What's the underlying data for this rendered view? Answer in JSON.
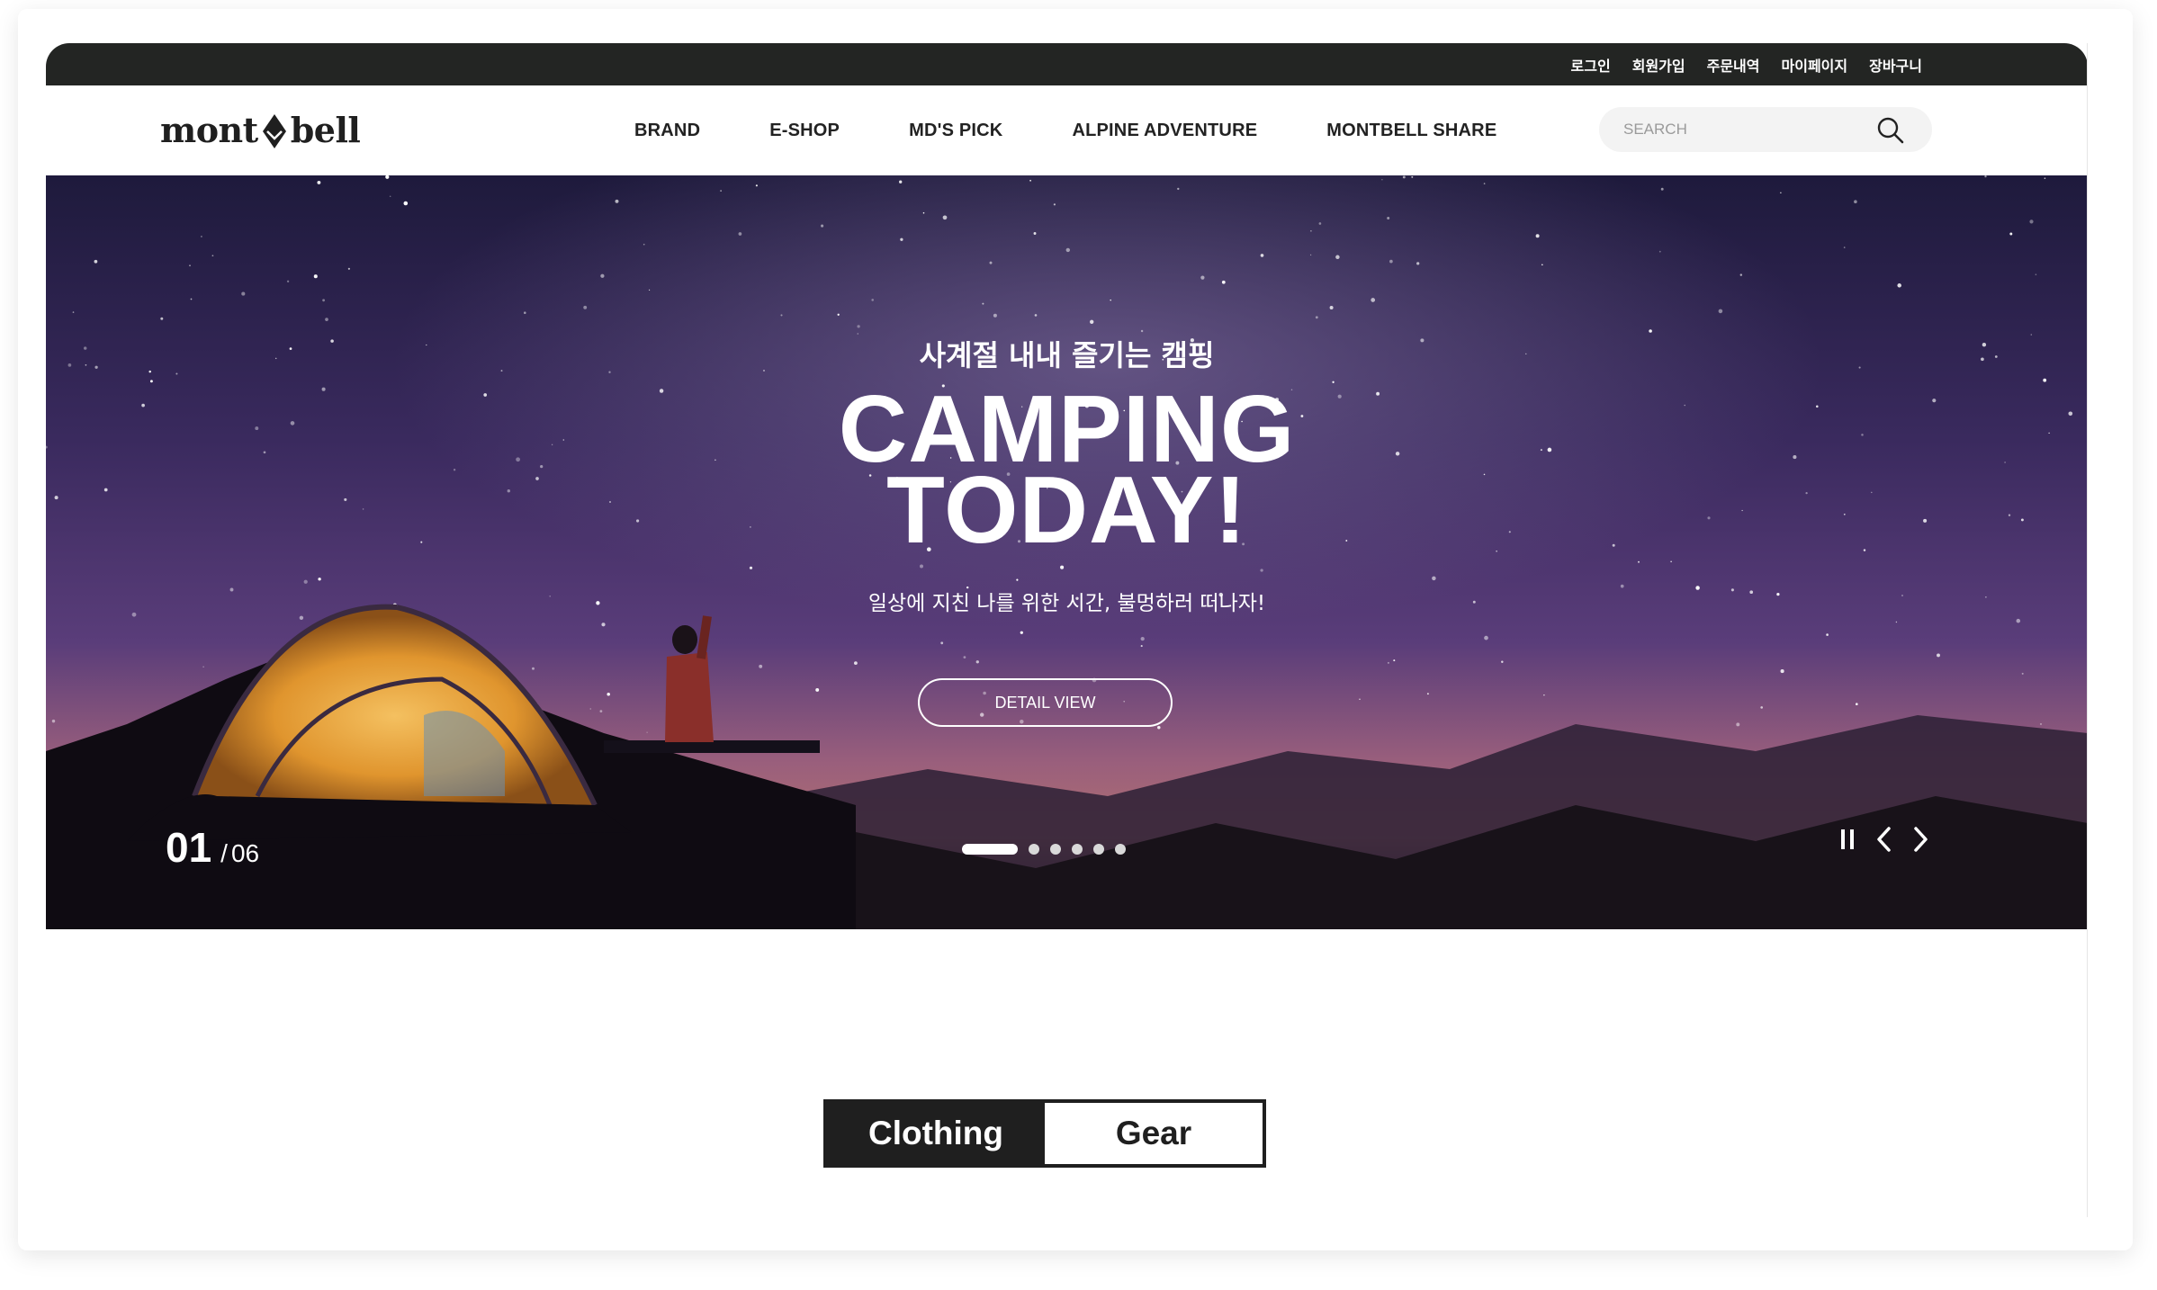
{
  "utility_nav": {
    "items": [
      "로그인",
      "회원가입",
      "주문내역",
      "마이페이지",
      "장바구니"
    ]
  },
  "header": {
    "logo": {
      "left": "mont",
      "right": "bell"
    },
    "nav": [
      "BRAND",
      "E-SHOP",
      "MD'S PICK",
      "ALPINE ADVENTURE",
      "MONTBELL SHARE"
    ],
    "search": {
      "placeholder": "SEARCH",
      "value": "",
      "icon": "search-icon"
    }
  },
  "hero": {
    "subtitle": "사계절 내내 즐기는 캠핑",
    "title_line1": "CAMPING",
    "title_line2": "TODAY!",
    "description": "일상에 지친 나를 위한 시간, 불멍하러 떠나자!",
    "cta_label": "DETAIL VIEW",
    "slide": {
      "current": "01",
      "separator": "/",
      "total": "06"
    },
    "dots_count": 6,
    "active_dot": 0,
    "controls": [
      "pause-icon",
      "chevron-left-icon",
      "chevron-right-icon"
    ]
  },
  "tabs": {
    "items": [
      {
        "label": "Clothing",
        "active": true
      },
      {
        "label": "Gear",
        "active": false
      }
    ]
  },
  "colors": {
    "dark": "#232523",
    "tab_dark": "#1f1f1f",
    "search_bg": "#f3f3f3",
    "sky_top": "#1e1a3c",
    "sky_mid": "#5a3d7a",
    "glow": "#c07a7a",
    "tent": "#e8a23a"
  }
}
